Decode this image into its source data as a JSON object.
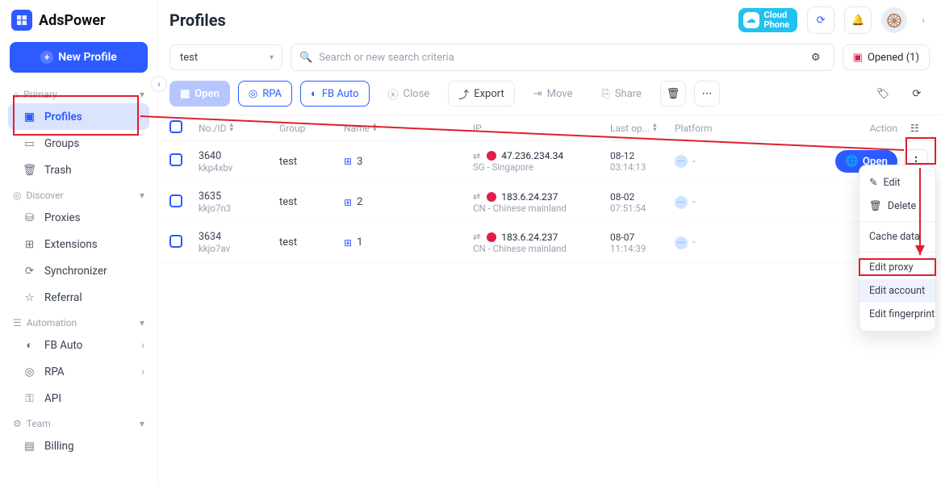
{
  "brand": "AdsPower",
  "new_profile_label": "New Profile",
  "sidebar": {
    "primary_label": "Primary",
    "items": [
      {
        "label": "Profiles"
      },
      {
        "label": "Groups"
      },
      {
        "label": "Trash"
      }
    ],
    "discover_label": "Discover",
    "discover_items": [
      {
        "label": "Proxies"
      },
      {
        "label": "Extensions"
      },
      {
        "label": "Synchronizer"
      },
      {
        "label": "Referral"
      }
    ],
    "automation_label": "Automation",
    "automation_items": [
      {
        "label": "FB Auto"
      },
      {
        "label": "RPA"
      },
      {
        "label": "API"
      }
    ],
    "team_label": "Team",
    "team_items": [
      {
        "label": "Billing"
      }
    ]
  },
  "header": {
    "title": "Profiles",
    "cloudphone_line1": "Cloud",
    "cloudphone_line2": "Phone"
  },
  "filterbar": {
    "dropdown_value": "test",
    "search_placeholder": "Search or new search criteria",
    "opened_label": "Opened (1)"
  },
  "toolbar": {
    "open": "Open",
    "rpa": "RPA",
    "fb_auto": "FB Auto",
    "close": "Close",
    "export": "Export",
    "move": "Move",
    "share": "Share"
  },
  "table": {
    "headers": {
      "no": "No./ID",
      "group": "Group",
      "name": "Name",
      "ip": "IP",
      "last": "Last op...",
      "platform": "Platform",
      "action": "Action"
    },
    "rows": [
      {
        "no": "3640",
        "sub": "kkp4xbv",
        "group": "test",
        "name_num": "3",
        "ip": "47.236.234.34",
        "loc": "SG - Singapore",
        "date": "08-12",
        "time": "03:14:13",
        "open_full": true
      },
      {
        "no": "3635",
        "sub": "kkjo7n3",
        "group": "test",
        "name_num": "2",
        "ip": "183.6.24.237",
        "loc": "CN - Chinese mainland",
        "date": "08-02",
        "time": "07:51:54",
        "open_full": false
      },
      {
        "no": "3634",
        "sub": "kkjo7av",
        "group": "test",
        "name_num": "1",
        "ip": "183.6.24.237",
        "loc": "CN - Chinese mainland",
        "date": "08-07",
        "time": "11:14:39",
        "open_full": false
      }
    ]
  },
  "context_menu": {
    "edit": "Edit",
    "delete": "Delete",
    "cache": "Cache data",
    "edit_proxy": "Edit proxy",
    "edit_account": "Edit account",
    "edit_fingerprint": "Edit fingerprint"
  },
  "row_open_label": "Open",
  "dash": "-"
}
